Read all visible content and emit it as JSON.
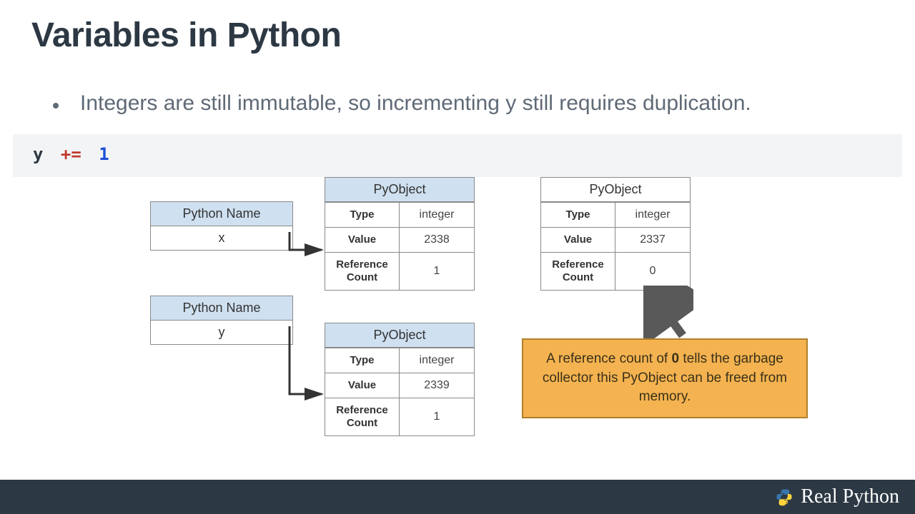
{
  "title": "Variables in Python",
  "bullet": "Integers are still immutable, so incrementing y still requires duplication.",
  "code": {
    "var": "y",
    "op": "+=",
    "num": "1"
  },
  "name_table_header": "Python Name",
  "names": {
    "x": "x",
    "y": "y"
  },
  "pyobject_header": "PyObject",
  "labels": {
    "type": "Type",
    "value": "Value",
    "refcount": "Reference Count"
  },
  "obj_a": {
    "type": "integer",
    "value": "2338",
    "refcount": "1"
  },
  "obj_b": {
    "type": "integer",
    "value": "2339",
    "refcount": "1"
  },
  "obj_c": {
    "type": "integer",
    "value": "2337",
    "refcount": "0"
  },
  "callout": {
    "pre": "A reference count of ",
    "bold": "0",
    "post": " tells the garbage collector this PyObject can be freed from memory."
  },
  "footer": {
    "brand": "Real Python"
  }
}
